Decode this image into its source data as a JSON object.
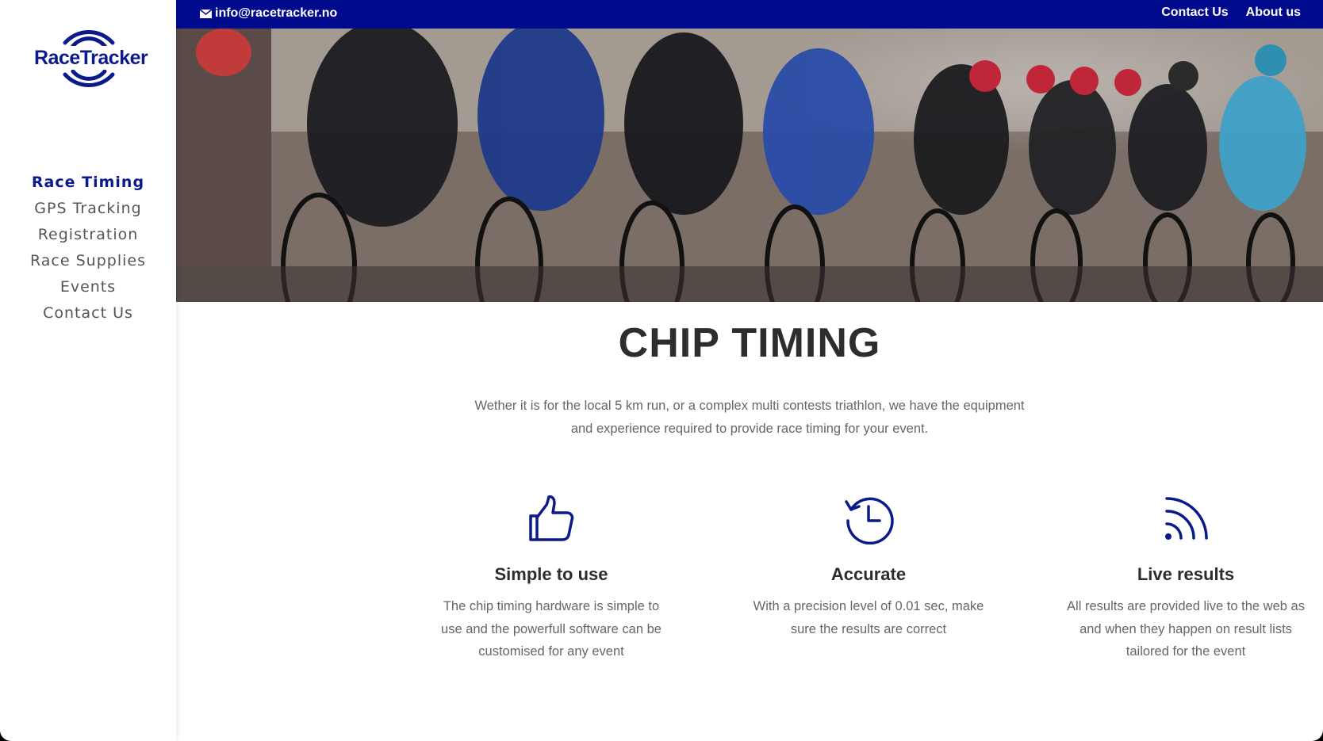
{
  "logo": {
    "text": "RaceTracker"
  },
  "nav": {
    "items": [
      {
        "label": "Race Timing",
        "active": true
      },
      {
        "label": "GPS Tracking",
        "active": false
      },
      {
        "label": "Registration",
        "active": false
      },
      {
        "label": "Race Supplies",
        "active": false
      },
      {
        "label": "Events",
        "active": false
      },
      {
        "label": "Contact Us",
        "active": false
      }
    ]
  },
  "topbar": {
    "email": "info@racetracker.no",
    "email_icon": "envelope-icon",
    "links": [
      "Contact Us",
      "About us"
    ]
  },
  "hero": {
    "image": "cyclists-peloton-photo"
  },
  "main": {
    "title": "CHIP TIMING",
    "subtitle": "Wether it is for the local 5 km run, or a complex multi contests triathlon, we have the equipment and experience required to provide race timing for your event.",
    "features": [
      {
        "icon": "thumbs-up-icon",
        "title": "Simple to use",
        "text": "The chip timing hardware is simple to use and the powerfull software can be customised for any event"
      },
      {
        "icon": "clock-history-icon",
        "title": "Accurate",
        "text": "With a precision level of 0.01 sec, make sure the results are correct"
      },
      {
        "icon": "rss-feed-icon",
        "title": "Live results",
        "text": "All results are provided live to the web as and when they happen on result lists tailored for the event"
      }
    ]
  },
  "colors": {
    "brand": "#000a8c",
    "text": "#2d2d2d",
    "muted": "#666666"
  }
}
